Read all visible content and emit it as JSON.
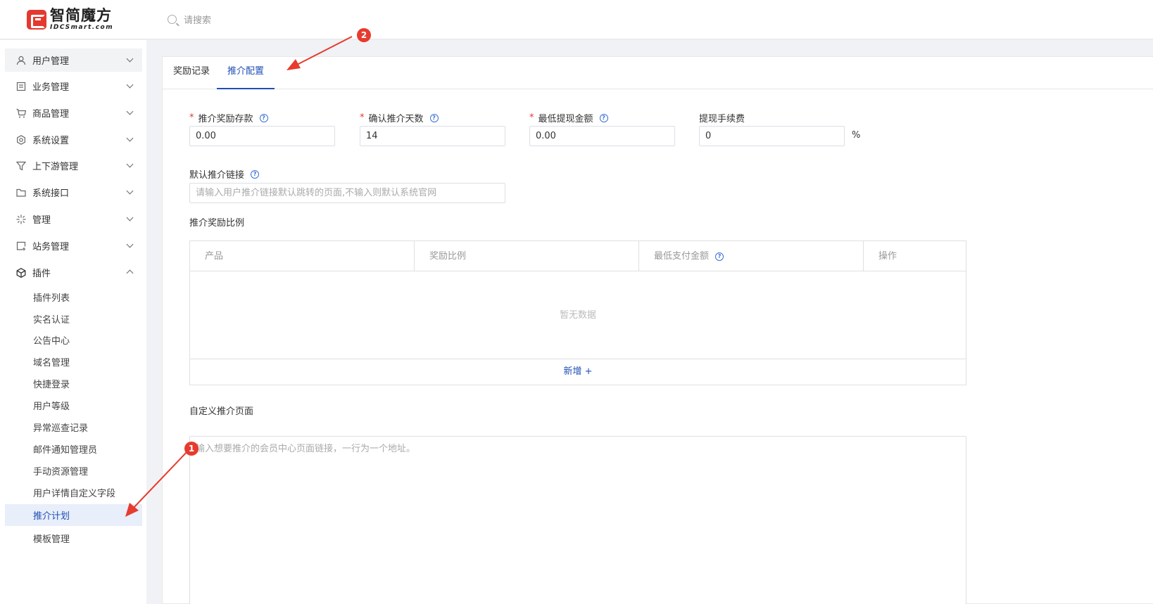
{
  "header": {
    "logo_cn": "智简魔方",
    "logo_en": "IDCSmart.com",
    "search_placeholder": "请搜索"
  },
  "sidebar": {
    "items": [
      {
        "label": "用户管理",
        "icon": "user-icon"
      },
      {
        "label": "业务管理",
        "icon": "document-icon"
      },
      {
        "label": "商品管理",
        "icon": "cart-icon"
      },
      {
        "label": "系统设置",
        "icon": "settings-icon"
      },
      {
        "label": "上下游管理",
        "icon": "filter-icon"
      },
      {
        "label": "系统接口",
        "icon": "folder-icon"
      },
      {
        "label": "管理",
        "icon": "sparkle-icon"
      },
      {
        "label": "站务管理",
        "icon": "site-icon"
      },
      {
        "label": "插件",
        "icon": "cube-icon"
      }
    ],
    "plugin_sub_items": [
      "插件列表",
      "实名认证",
      "公告中心",
      "域名管理",
      "快捷登录",
      "用户等级",
      "异常巡查记录",
      "邮件通知管理员",
      "手动资源管理",
      "用户详情自定义字段",
      "推介计划",
      "模板管理"
    ],
    "active_sub_item": "推介计划"
  },
  "tabs": [
    {
      "label": "奖励记录",
      "active": false
    },
    {
      "label": "推介配置",
      "active": true
    }
  ],
  "form": {
    "reward_deposit": {
      "label": "推介奖励存款",
      "value": "0.00",
      "required": true
    },
    "confirm_days": {
      "label": "确认推介天数",
      "value": "14",
      "required": true
    },
    "min_withdraw": {
      "label": "最低提现金额",
      "value": "0.00",
      "required": true
    },
    "withdraw_fee": {
      "label": "提现手续费",
      "value": "0",
      "unit": "%",
      "required": false
    },
    "default_link": {
      "label": "默认推介链接",
      "placeholder": "请输入用户推介链接默认跳转的页面,不输入则默认系统官网"
    },
    "reward_ratio_title": "推介奖励比例",
    "table": {
      "columns": [
        "产品",
        "奖励比例",
        "最低支付金额",
        "操作"
      ],
      "empty_text": "暂无数据",
      "add_label": "新增 +"
    },
    "custom_page": {
      "label": "自定义推介页面",
      "placeholder": "输入想要推介的会员中心页面链接，一行为一个地址。"
    }
  },
  "annotations": {
    "badge_1": "1",
    "badge_2": "2",
    "arrow_color": "#e63b2e"
  },
  "colors": {
    "accent": "#1f4fb4",
    "required": "#e4392f",
    "brand": "#e4392f"
  }
}
